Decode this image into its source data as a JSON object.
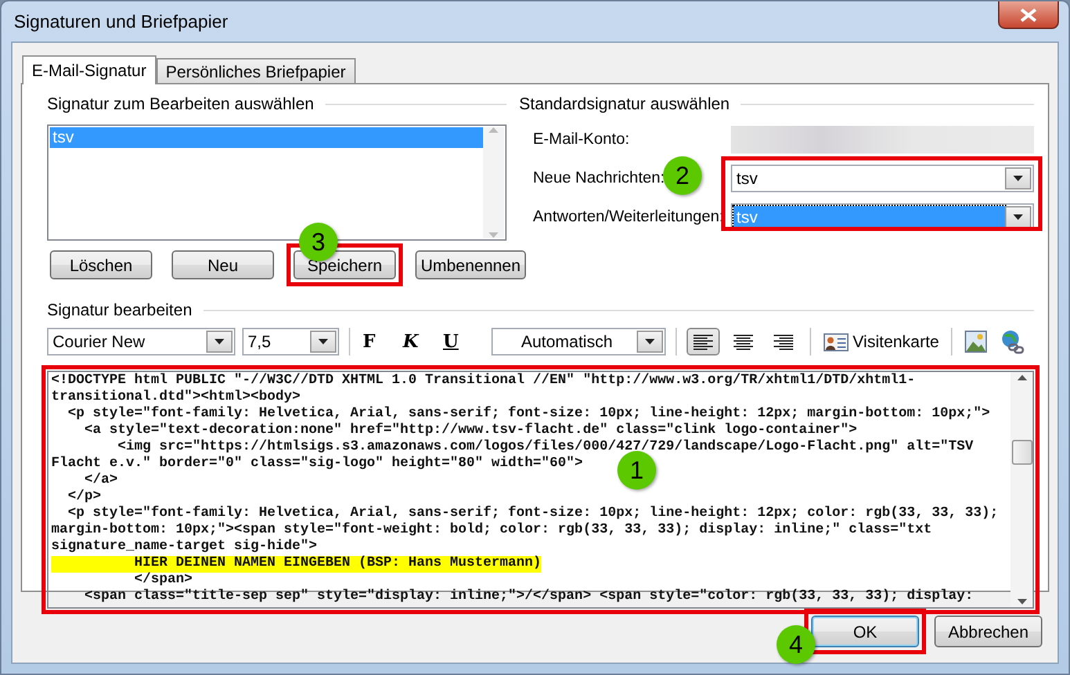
{
  "window": {
    "title": "Signaturen und Briefpapier"
  },
  "tabs": [
    {
      "label": "E-Mail-Signatur",
      "selected": true
    },
    {
      "label": "Persönliches Briefpapier",
      "selected": false
    }
  ],
  "select_signature": {
    "heading": "Signatur zum Bearbeiten auswählen",
    "items": [
      {
        "label": "tsv",
        "selected": true
      }
    ],
    "buttons": [
      {
        "label": "Löschen",
        "highlighted": false
      },
      {
        "label": "Neu",
        "highlighted": false
      },
      {
        "label": "Speichern",
        "highlighted": true,
        "callout": "3"
      },
      {
        "label": "Umbenennen",
        "highlighted": false
      }
    ]
  },
  "default_signature": {
    "heading": "Standardsignatur auswählen",
    "highlighted": true,
    "callout": "2",
    "fields": [
      {
        "label": "E-Mail-Konto:",
        "kind": "redacted"
      },
      {
        "label": "Neue Nachrichten:",
        "kind": "dropdown",
        "value": "tsv",
        "focused": false
      },
      {
        "label": "Antworten/Weiterleitungen:",
        "kind": "dropdown",
        "value": "tsv",
        "focused": true
      }
    ]
  },
  "edit_signature": {
    "heading": "Signatur bearbeiten",
    "font": "Courier New",
    "size": "7,5",
    "format_buttons": [
      "F",
      "K",
      "U"
    ],
    "font_color": "Automatisch",
    "alignment": [
      {
        "kind": "left",
        "selected": true
      },
      {
        "kind": "center",
        "selected": false
      },
      {
        "kind": "right",
        "selected": false
      }
    ],
    "business_card": "Visitenkarte",
    "editor": {
      "highlighted": true,
      "callout": "1",
      "lines": [
        {
          "text": "<!DOCTYPE html PUBLIC \"-//W3C//DTD XHTML 1.0 Transitional //EN\" \"http://www.w3.org/TR/xhtml1/DTD/xhtml1-",
          "highlighted": false
        },
        {
          "text": "transitional.dtd\"><html><body>",
          "highlighted": false
        },
        {
          "text": "  <p style=\"font-family: Helvetica, Arial, sans-serif; font-size: 10px; line-height: 12px; margin-bottom: 10px;\">",
          "highlighted": false
        },
        {
          "text": "    <a style=\"text-decoration:none\" href=\"http://www.tsv-flacht.de\" class=\"clink logo-container\">",
          "highlighted": false
        },
        {
          "text": "        <img src=\"https://htmlsigs.s3.amazonaws.com/logos/files/000/427/729/landscape/Logo-Flacht.png\" alt=\"TSV",
          "highlighted": false
        },
        {
          "text": "Flacht e.v.\" border=\"0\" class=\"sig-logo\" height=\"80\" width=\"60\">",
          "highlighted": false
        },
        {
          "text": "    </a>",
          "highlighted": false
        },
        {
          "text": "  </p>",
          "highlighted": false
        },
        {
          "text": "  <p style=\"font-family: Helvetica, Arial, sans-serif; font-size: 10px; line-height: 12px; color: rgb(33, 33, 33);",
          "highlighted": false
        },
        {
          "text": "margin-bottom: 10px;\"><span style=\"font-weight: bold; color: rgb(33, 33, 33); display: inline;\" class=\"txt",
          "highlighted": false
        },
        {
          "text": "signature_name-target sig-hide\">",
          "highlighted": false
        },
        {
          "text": "          HIER DEINEN NAMEN EINGEBEN (BSP: Hans Mustermann)",
          "highlighted": true
        },
        {
          "text": "          </span>",
          "highlighted": false
        },
        {
          "text": "    <span class=\"title-sep sep\" style=\"display: inline;\">/</span> <span style=\"color: rgb(33, 33, 33); display:",
          "highlighted": false
        }
      ]
    }
  },
  "footer_buttons": [
    {
      "label": "OK",
      "highlighted": true,
      "callout": "4",
      "default": true
    },
    {
      "label": "Abbrechen",
      "highlighted": false,
      "default": false
    }
  ]
}
